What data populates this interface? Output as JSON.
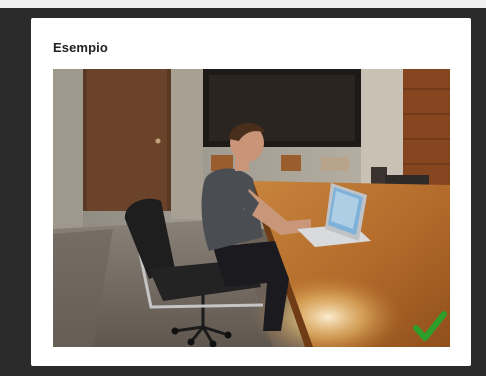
{
  "dialog": {
    "title": "Esempio"
  },
  "example_photo": {
    "status_icon": "checkmark-icon",
    "status_color": "#2e9e2a"
  }
}
